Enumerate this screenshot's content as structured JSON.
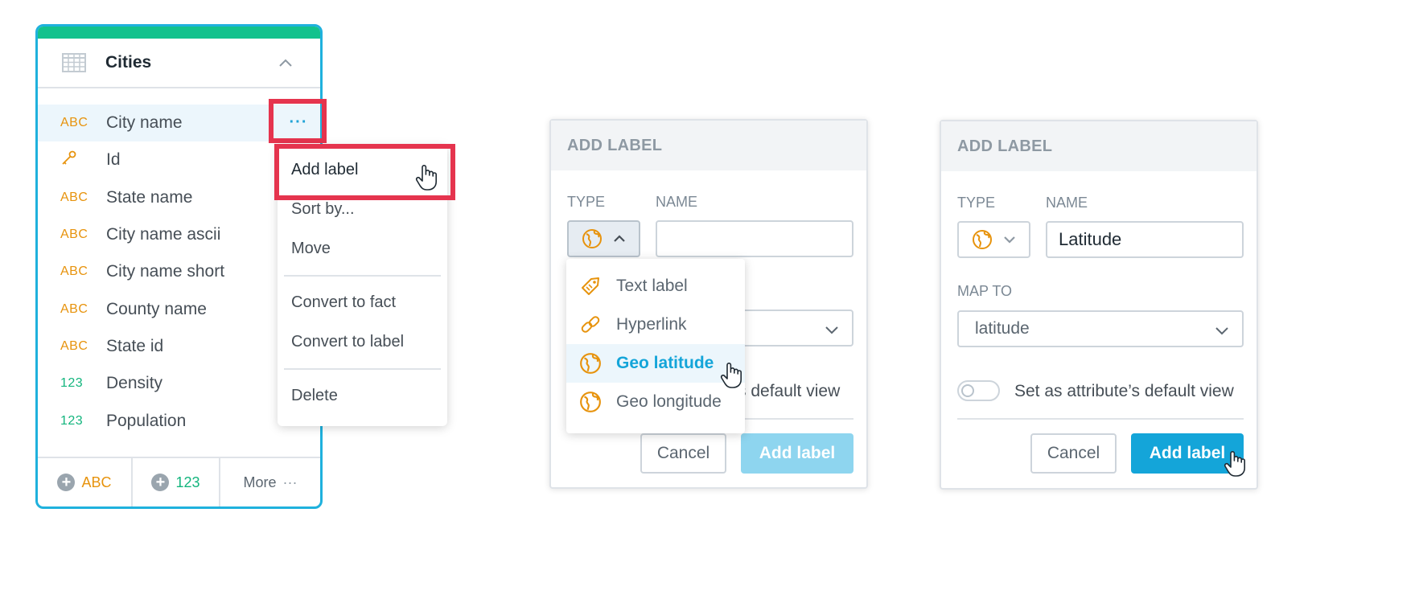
{
  "dataset": {
    "title": "Cities",
    "fields": [
      {
        "type": "ABC",
        "kind": "text",
        "label": "City name"
      },
      {
        "type": "",
        "kind": "key",
        "label": "Id"
      },
      {
        "type": "ABC",
        "kind": "text",
        "label": "State name"
      },
      {
        "type": "ABC",
        "kind": "text",
        "label": "City name ascii"
      },
      {
        "type": "ABC",
        "kind": "text",
        "label": "City name short"
      },
      {
        "type": "ABC",
        "kind": "text",
        "label": "County name"
      },
      {
        "type": "ABC",
        "kind": "text",
        "label": "State id"
      },
      {
        "type": "123",
        "kind": "number",
        "label": "Density"
      },
      {
        "type": "123",
        "kind": "number",
        "label": "Population"
      }
    ],
    "more_dots": "···",
    "footer": {
      "add_attribute": "ABC",
      "add_fact": "123",
      "more": "More",
      "more_dots": "···"
    }
  },
  "context_menu": {
    "items": [
      "Add label",
      "Sort by...",
      "Move",
      "Convert to fact",
      "Convert to label",
      "Delete"
    ]
  },
  "dialog1": {
    "header": "ADD LABEL",
    "type_label": "TYPE",
    "name_label": "NAME",
    "name_value": "",
    "toggle_text_partial": "s default view",
    "cancel": "Cancel",
    "add": "Add label",
    "dropdown": [
      {
        "label": "Text label",
        "icon": "tag-icon"
      },
      {
        "label": "Hyperlink",
        "icon": "link-icon"
      },
      {
        "label": "Geo latitude",
        "icon": "globe-icon"
      },
      {
        "label": "Geo longitude",
        "icon": "globe-icon"
      }
    ]
  },
  "dialog2": {
    "header": "ADD LABEL",
    "type_label": "TYPE",
    "name_label": "NAME",
    "name_value": "Latitude",
    "map_to_label": "MAP TO",
    "map_to_value": "latitude",
    "toggle_text": "Set as attribute’s default view",
    "cancel": "Cancel",
    "add": "Add label"
  },
  "colors": {
    "accent": "#14a5d9",
    "highlight": "#e5344e",
    "card_top": "#13c28d",
    "text_type": "#e7930d",
    "number_type": "#13b57d"
  }
}
